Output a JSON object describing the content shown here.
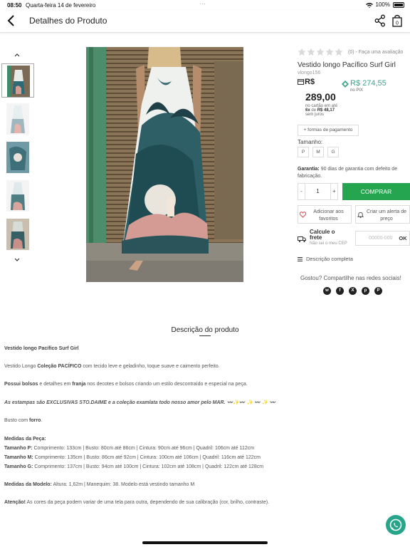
{
  "status_bar": {
    "time": "08:50",
    "date": "Quarta-feira 14 de fevereiro",
    "battery": "100%"
  },
  "header": {
    "title": "Detalhes do Produto",
    "icons": [
      "back-arrow-icon",
      "share-icon",
      "shopping-bag-icon"
    ],
    "bag_count": "0"
  },
  "gallery": {
    "thumbnail_count": 5,
    "active_index": 0
  },
  "product": {
    "rating_text": "(0) - Faça uma avaliação",
    "rating_stars": 0,
    "name": "Vestido longo Pacífico Surf Girl",
    "sku": "vlongo156",
    "currency": "R$",
    "price": "289,00",
    "installments_line1": "no cartão em até",
    "installments_count": "6x",
    "installments_de": "de",
    "installments_value": "R$ 48,17",
    "installments_line3": "sem juros",
    "pix_price": "R$ 274,55",
    "pix_label": "no PIX",
    "more_payment": "+ formas de pagamento",
    "size_label": "Tamanho:",
    "sizes": [
      "P",
      "M",
      "G"
    ],
    "guarantee_label": "Garantia:",
    "guarantee_text": "90 dias de garantia com defeito de fabricação.",
    "quantity": "1",
    "qty_minus": "-",
    "qty_plus": "+",
    "buy_label": "COMPRAR",
    "favorite_label": "Adicionar aos favoritos",
    "alert_label": "Criar um alerta de preço",
    "shipping_title": "Calcule o frete",
    "shipping_help": "Não sei o meu CEP",
    "cep_placeholder": "00000-000",
    "ok_label": "OK",
    "full_description_link": "Descrição completa",
    "share_title": "Gostou? Compartilhe nas redes sociais!",
    "socials": [
      {
        "icon": "whatsapp-icon",
        "glyph": "w"
      },
      {
        "icon": "facebook-icon",
        "glyph": "f"
      },
      {
        "icon": "x-icon",
        "glyph": "X"
      },
      {
        "icon": "pinterest-icon",
        "glyph": "p"
      },
      {
        "icon": "pinterest-alt-icon",
        "glyph": "P"
      }
    ]
  },
  "description": {
    "title": "Descrição do produto",
    "l1": "Vestido longo Pacífico Surf Girl",
    "l2a": "Vestido Longo ",
    "l2b": "Coleção PACÍFICO",
    "l2c": " com tecido leve e geladinho, toque suave e caimento perfeito.",
    "l3a": "Possui bolsos",
    "l3b": " e detalhes em ",
    "l3c": "franja",
    "l3d": " nos decotes e bolsos criando um estilo descontraído e especial na peça.",
    "l4": "As estampas são EXCLUSIVAS STO.DAIME e a coleção examlata todo nosso amor pelo MAR. 〰️✨〰️ ✨ 〰️ ✨ 〰️",
    "l5a": "Busto com ",
    "l5b": "forro",
    "l5c": ".",
    "l6": "Medidas da Peça:",
    "l7a": "Tamanho P:",
    "l7b": " Comprimento: 133cm | Busto: 80cm até 86cm | Cintura: 90cm até 96cm | Quadril: 106cm até 112cm",
    "l8a": "Tamanho M:",
    "l8b": " Comprimento: 135cm | Busto: 86cm até 92cm | Cintura: 100cm até 106cm | Quadril: 116cm até 122cm",
    "l9a": "Tamanho G:",
    "l9b": " Comprimento: 137cm | Busto: 94cm até 100cm | Cintura: 102cm até 108cm | Quadril: 122cm até 128cm",
    "l10a": "Medidas da Modelo:",
    "l10b": " Altura: 1,62m | Manequim: 38. Modelo está vestindo tamanho M",
    "l11a": "Atenção!",
    "l11b": " As cores da peça podem variar de uma tela para outra, dependendo de sua calibração (cor, brilho, contraste)."
  },
  "colors": {
    "buy_green": "#26a550",
    "pix_teal": "#3fa58a",
    "whatsapp_fab": "#26a58a"
  }
}
